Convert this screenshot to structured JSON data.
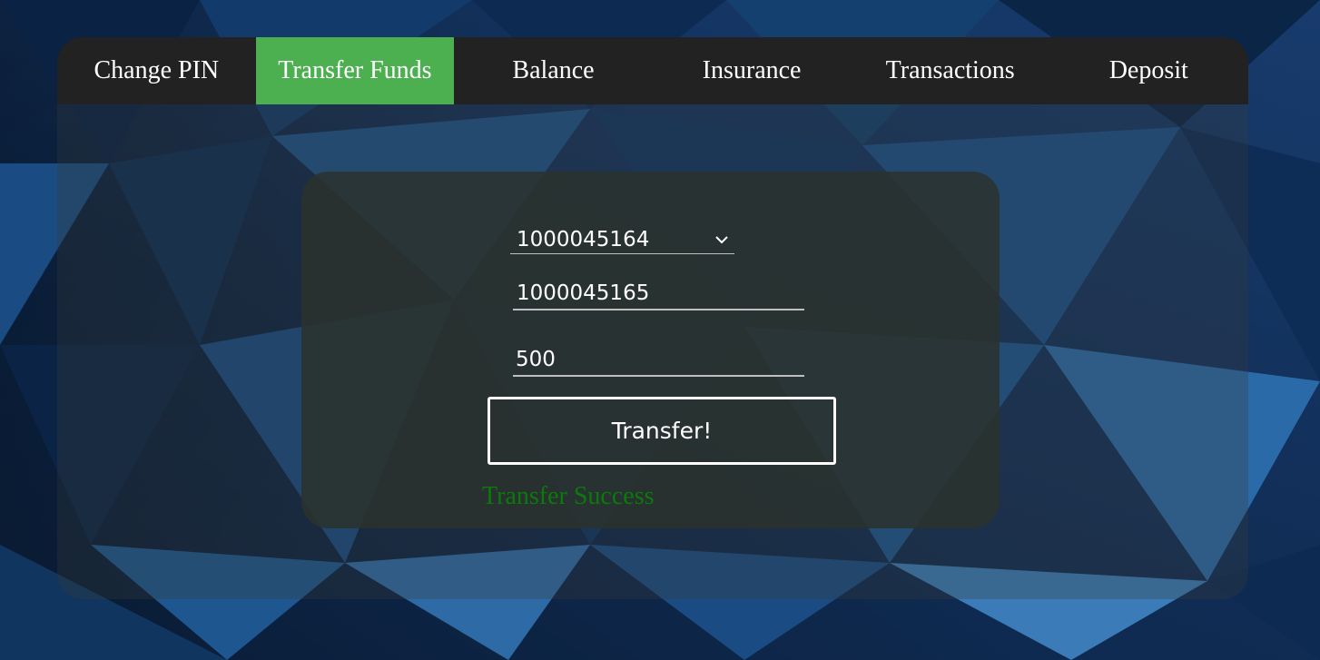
{
  "nav": {
    "items": [
      {
        "label": "Change PIN"
      },
      {
        "label": "Transfer Funds",
        "active": true
      },
      {
        "label": "Balance"
      },
      {
        "label": "Insurance"
      },
      {
        "label": "Transactions"
      },
      {
        "label": "Deposit"
      }
    ]
  },
  "transfer_form": {
    "from_account": {
      "selected": "1000045164"
    },
    "to_account": {
      "value": "1000045165"
    },
    "amount": {
      "value": "500"
    },
    "submit_label": "Transfer!",
    "status_message": "Transfer Success"
  },
  "colors": {
    "active_tab": "#4caf50",
    "nav_background": "#222222",
    "success_text": "#0b7a0b",
    "background": "#0f2b52"
  },
  "icons": {
    "dropdown": "chevron-down-icon"
  }
}
